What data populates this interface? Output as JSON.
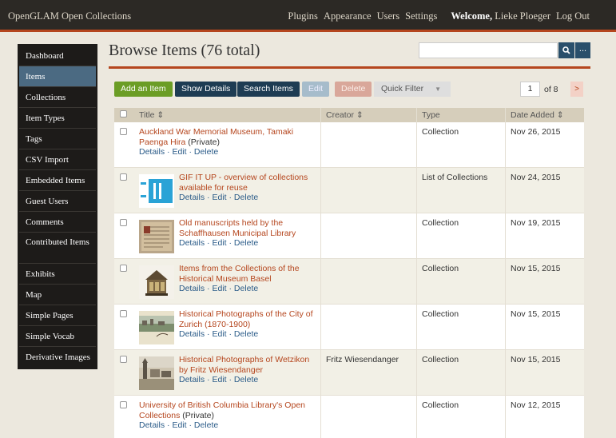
{
  "topbar": {
    "site_title": "OpenGLAM Open Collections",
    "nav": [
      "Plugins",
      "Appearance",
      "Users",
      "Settings"
    ],
    "welcome_label": "Welcome,",
    "user_name": "Lieke Ploeger",
    "logout": "Log Out"
  },
  "sidebar": {
    "items": [
      {
        "label": "Dashboard"
      },
      {
        "label": "Items"
      },
      {
        "label": "Collections"
      },
      {
        "label": "Item Types"
      },
      {
        "label": "Tags"
      },
      {
        "label": "CSV Import"
      },
      {
        "label": "Embedded Items"
      },
      {
        "label": "Guest Users"
      },
      {
        "label": "Comments"
      },
      {
        "label": "Contributed Items"
      },
      {
        "label": "Exhibits"
      },
      {
        "label": "Map"
      },
      {
        "label": "Simple Pages"
      },
      {
        "label": "Simple Vocab"
      },
      {
        "label": "Derivative Images"
      }
    ],
    "active": "Items"
  },
  "page": {
    "title": "Browse Items (76 total)"
  },
  "search": {
    "value": "",
    "button_icon": "search-icon",
    "advanced_label": "..."
  },
  "toolbar": {
    "add_item": "Add an Item",
    "show_details": "Show Details",
    "search_items": "Search Items",
    "edit": "Edit",
    "delete": "Delete",
    "quick_filter": "Quick Filter"
  },
  "pagination": {
    "current_page": "1",
    "of_text": "of 8",
    "next": ">"
  },
  "table": {
    "headers": {
      "title": "Title ⇕",
      "creator": "Creator ⇕",
      "type": "Type",
      "date_added": "Date Added ⇕"
    },
    "action_details": "Details",
    "action_edit": "Edit",
    "action_delete": "Delete",
    "private_label": "(Private)",
    "rows": [
      {
        "title": "Auckland War Memorial Museum, Tamaki Paenga Hira",
        "private": true,
        "thumb": "none",
        "creator": "",
        "type": "Collection",
        "date": "Nov 26, 2015"
      },
      {
        "title": "GIF IT UP - overview of collections available for reuse",
        "private": false,
        "thumb": "gif-logo",
        "creator": "",
        "type": "List of Collections",
        "date": "Nov 24, 2015"
      },
      {
        "title": "Old manuscripts held by the Schaffhausen Municipal Library",
        "private": false,
        "thumb": "manuscript",
        "creator": "",
        "type": "Collection",
        "date": "Nov 19, 2015"
      },
      {
        "title": "Items from the Collections of the Historical Museum Basel",
        "private": false,
        "thumb": "shrine",
        "creator": "",
        "type": "Collection",
        "date": "Nov 15, 2015"
      },
      {
        "title": "Historical Photographs of the City of Zurich (1870-1900)",
        "private": false,
        "thumb": "postcard",
        "creator": "",
        "type": "Collection",
        "date": "Nov 15, 2015"
      },
      {
        "title": "Historical Photographs of Wetzikon by Fritz Wiesendanger",
        "private": false,
        "thumb": "village",
        "creator": "Fritz Wiesendanger",
        "type": "Collection",
        "date": "Nov 15, 2015"
      },
      {
        "title": "University of British Columbia Library's Open Collections",
        "private": true,
        "thumb": "none",
        "creator": "",
        "type": "Collection",
        "date": "Nov 12, 2015"
      }
    ]
  }
}
